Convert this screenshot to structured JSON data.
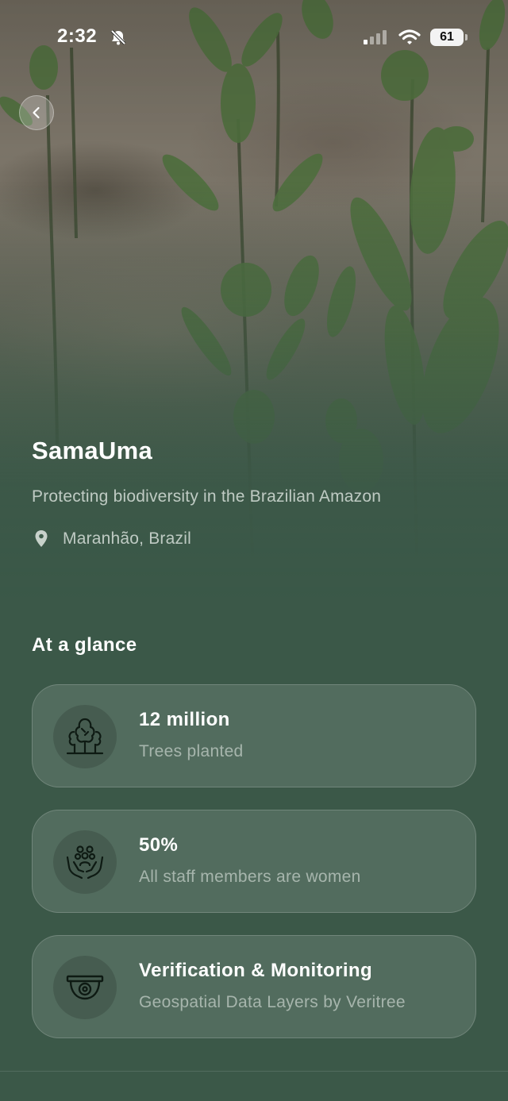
{
  "status_bar": {
    "time": "2:32",
    "battery": "61"
  },
  "project": {
    "name": "SamaUma",
    "tagline": "Protecting biodiversity in the Brazilian Amazon",
    "location": "Maranhão, Brazil"
  },
  "at_a_glance": {
    "heading": "At a glance",
    "items": [
      {
        "icon": "trees-icon",
        "value": "12 million",
        "label": "Trees planted"
      },
      {
        "icon": "hands-people-icon",
        "value": "50%",
        "label": "All staff members are women"
      },
      {
        "icon": "camera-monitoring-icon",
        "value": "Verification & Monitoring",
        "label": "Geospatial Data Layers by Veritree"
      }
    ]
  },
  "colors": {
    "background": "#3b5848",
    "card": "rgba(255,255,255,0.12)",
    "text_primary": "#ffffff"
  }
}
